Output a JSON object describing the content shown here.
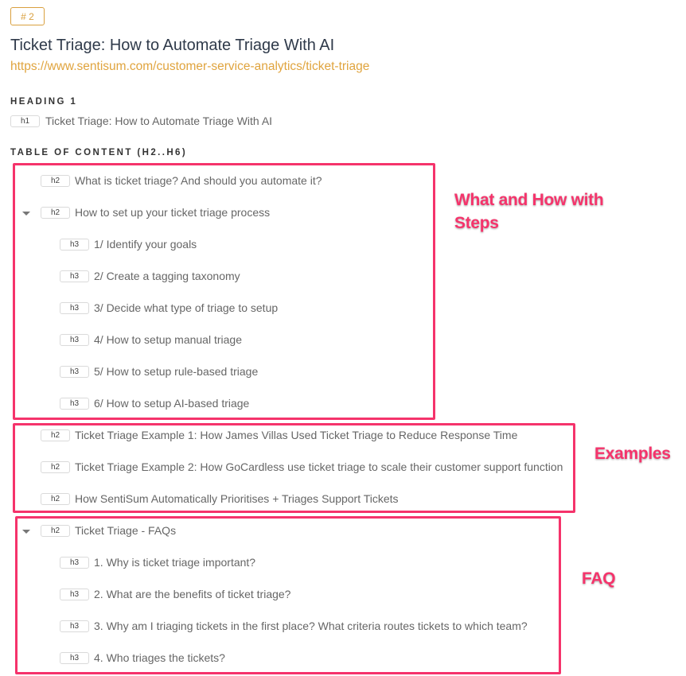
{
  "rank_badge": "# 2",
  "page": {
    "title": "Ticket Triage: How to Automate Triage With AI",
    "url": "https://www.sentisum.com/customer-service-analytics/ticket-triage"
  },
  "heading1": {
    "label": "HEADING 1",
    "tag": "h1",
    "text": "Ticket Triage: How to Automate Triage With AI"
  },
  "toc": {
    "label": "TABLE OF CONTENT (H2..H6)",
    "items": [
      {
        "tag": "h2",
        "text": "What is ticket triage? And should you automate it?",
        "collapsible": false
      },
      {
        "tag": "h2",
        "text": "How to set up your ticket triage process",
        "collapsible": true,
        "expanded": true
      },
      {
        "tag": "h3",
        "text": "1/ Identify your goals"
      },
      {
        "tag": "h3",
        "text": "2/ Create a tagging taxonomy"
      },
      {
        "tag": "h3",
        "text": "3/ Decide what type of triage to setup"
      },
      {
        "tag": "h3",
        "text": "4/ How to setup manual triage"
      },
      {
        "tag": "h3",
        "text": "5/ How to setup rule-based triage"
      },
      {
        "tag": "h3",
        "text": "6/ How to setup AI-based triage"
      },
      {
        "tag": "h2",
        "text": "Ticket Triage Example 1: How James Villas Used Ticket Triage to Reduce Response Time",
        "collapsible": false
      },
      {
        "tag": "h2",
        "text": "Ticket Triage Example 2: How GoCardless use ticket triage to scale their customer support function",
        "collapsible": false
      },
      {
        "tag": "h2",
        "text": "How SentiSum Automatically Prioritises + Triages Support Tickets",
        "collapsible": false
      },
      {
        "tag": "h2",
        "text": "Ticket Triage - FAQs",
        "collapsible": true,
        "expanded": true
      },
      {
        "tag": "h3",
        "text": "1. Why is ticket triage important?"
      },
      {
        "tag": "h3",
        "text": "2. What are the benefits of ticket triage?"
      },
      {
        "tag": "h3",
        "text": "3. Why am I triaging tickets in the first place? What criteria routes tickets to which team?"
      },
      {
        "tag": "h3",
        "text": "4. Who triages the tickets?"
      }
    ]
  },
  "annotations": {
    "what_how_line1": "What and How with",
    "what_how_line2": "Steps",
    "examples": "Examples",
    "faq": "FAQ"
  },
  "colors": {
    "accent_orange": "#e0a43e",
    "annotation_pink": "#f5336b",
    "title": "#2f3a4a"
  }
}
